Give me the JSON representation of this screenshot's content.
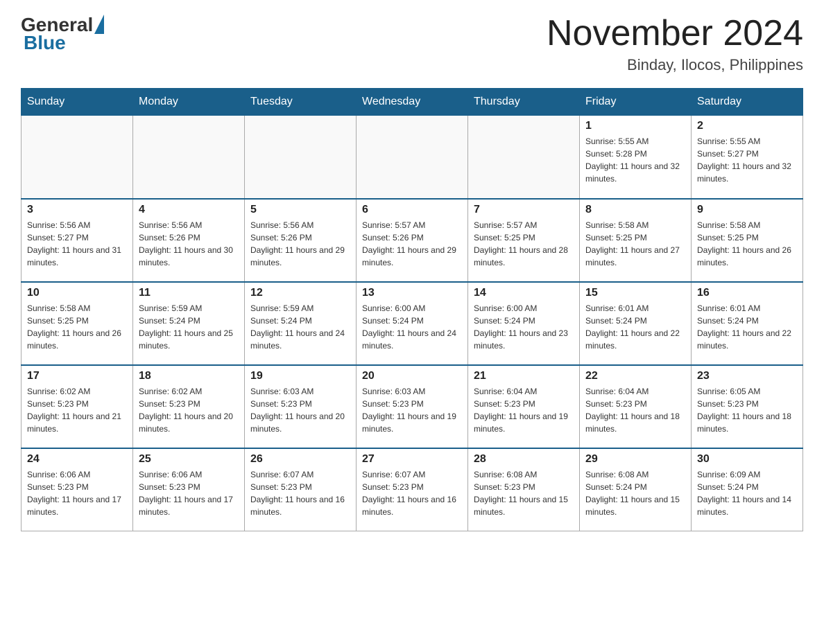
{
  "header": {
    "logo_general": "General",
    "logo_blue": "Blue",
    "title": "November 2024",
    "subtitle": "Binday, Ilocos, Philippines"
  },
  "days_of_week": [
    "Sunday",
    "Monday",
    "Tuesday",
    "Wednesday",
    "Thursday",
    "Friday",
    "Saturday"
  ],
  "weeks": [
    {
      "days": [
        {
          "num": "",
          "info": ""
        },
        {
          "num": "",
          "info": ""
        },
        {
          "num": "",
          "info": ""
        },
        {
          "num": "",
          "info": ""
        },
        {
          "num": "",
          "info": ""
        },
        {
          "num": "1",
          "info": "Sunrise: 5:55 AM\nSunset: 5:28 PM\nDaylight: 11 hours and 32 minutes."
        },
        {
          "num": "2",
          "info": "Sunrise: 5:55 AM\nSunset: 5:27 PM\nDaylight: 11 hours and 32 minutes."
        }
      ]
    },
    {
      "days": [
        {
          "num": "3",
          "info": "Sunrise: 5:56 AM\nSunset: 5:27 PM\nDaylight: 11 hours and 31 minutes."
        },
        {
          "num": "4",
          "info": "Sunrise: 5:56 AM\nSunset: 5:26 PM\nDaylight: 11 hours and 30 minutes."
        },
        {
          "num": "5",
          "info": "Sunrise: 5:56 AM\nSunset: 5:26 PM\nDaylight: 11 hours and 29 minutes."
        },
        {
          "num": "6",
          "info": "Sunrise: 5:57 AM\nSunset: 5:26 PM\nDaylight: 11 hours and 29 minutes."
        },
        {
          "num": "7",
          "info": "Sunrise: 5:57 AM\nSunset: 5:25 PM\nDaylight: 11 hours and 28 minutes."
        },
        {
          "num": "8",
          "info": "Sunrise: 5:58 AM\nSunset: 5:25 PM\nDaylight: 11 hours and 27 minutes."
        },
        {
          "num": "9",
          "info": "Sunrise: 5:58 AM\nSunset: 5:25 PM\nDaylight: 11 hours and 26 minutes."
        }
      ]
    },
    {
      "days": [
        {
          "num": "10",
          "info": "Sunrise: 5:58 AM\nSunset: 5:25 PM\nDaylight: 11 hours and 26 minutes."
        },
        {
          "num": "11",
          "info": "Sunrise: 5:59 AM\nSunset: 5:24 PM\nDaylight: 11 hours and 25 minutes."
        },
        {
          "num": "12",
          "info": "Sunrise: 5:59 AM\nSunset: 5:24 PM\nDaylight: 11 hours and 24 minutes."
        },
        {
          "num": "13",
          "info": "Sunrise: 6:00 AM\nSunset: 5:24 PM\nDaylight: 11 hours and 24 minutes."
        },
        {
          "num": "14",
          "info": "Sunrise: 6:00 AM\nSunset: 5:24 PM\nDaylight: 11 hours and 23 minutes."
        },
        {
          "num": "15",
          "info": "Sunrise: 6:01 AM\nSunset: 5:24 PM\nDaylight: 11 hours and 22 minutes."
        },
        {
          "num": "16",
          "info": "Sunrise: 6:01 AM\nSunset: 5:24 PM\nDaylight: 11 hours and 22 minutes."
        }
      ]
    },
    {
      "days": [
        {
          "num": "17",
          "info": "Sunrise: 6:02 AM\nSunset: 5:23 PM\nDaylight: 11 hours and 21 minutes."
        },
        {
          "num": "18",
          "info": "Sunrise: 6:02 AM\nSunset: 5:23 PM\nDaylight: 11 hours and 20 minutes."
        },
        {
          "num": "19",
          "info": "Sunrise: 6:03 AM\nSunset: 5:23 PM\nDaylight: 11 hours and 20 minutes."
        },
        {
          "num": "20",
          "info": "Sunrise: 6:03 AM\nSunset: 5:23 PM\nDaylight: 11 hours and 19 minutes."
        },
        {
          "num": "21",
          "info": "Sunrise: 6:04 AM\nSunset: 5:23 PM\nDaylight: 11 hours and 19 minutes."
        },
        {
          "num": "22",
          "info": "Sunrise: 6:04 AM\nSunset: 5:23 PM\nDaylight: 11 hours and 18 minutes."
        },
        {
          "num": "23",
          "info": "Sunrise: 6:05 AM\nSunset: 5:23 PM\nDaylight: 11 hours and 18 minutes."
        }
      ]
    },
    {
      "days": [
        {
          "num": "24",
          "info": "Sunrise: 6:06 AM\nSunset: 5:23 PM\nDaylight: 11 hours and 17 minutes."
        },
        {
          "num": "25",
          "info": "Sunrise: 6:06 AM\nSunset: 5:23 PM\nDaylight: 11 hours and 17 minutes."
        },
        {
          "num": "26",
          "info": "Sunrise: 6:07 AM\nSunset: 5:23 PM\nDaylight: 11 hours and 16 minutes."
        },
        {
          "num": "27",
          "info": "Sunrise: 6:07 AM\nSunset: 5:23 PM\nDaylight: 11 hours and 16 minutes."
        },
        {
          "num": "28",
          "info": "Sunrise: 6:08 AM\nSunset: 5:23 PM\nDaylight: 11 hours and 15 minutes."
        },
        {
          "num": "29",
          "info": "Sunrise: 6:08 AM\nSunset: 5:24 PM\nDaylight: 11 hours and 15 minutes."
        },
        {
          "num": "30",
          "info": "Sunrise: 6:09 AM\nSunset: 5:24 PM\nDaylight: 11 hours and 14 minutes."
        }
      ]
    }
  ]
}
